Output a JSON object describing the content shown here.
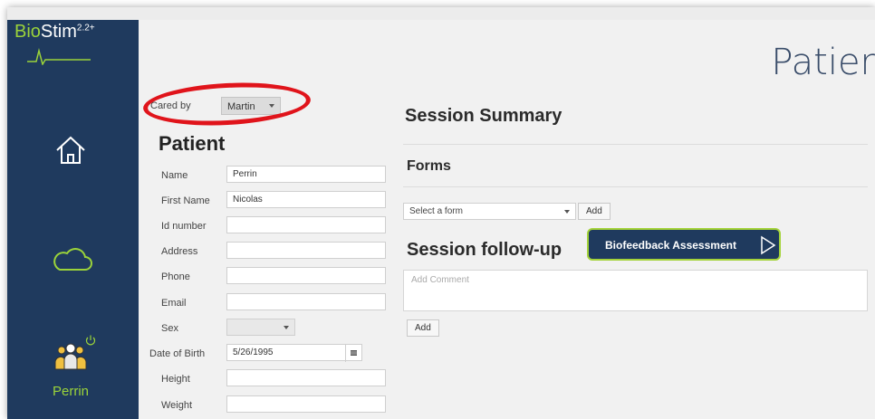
{
  "app": {
    "name": "BioStim",
    "version": "2.2+"
  },
  "sidebar": {
    "user": "Perrin",
    "items": [
      {
        "icon": "home-icon"
      },
      {
        "icon": "cloud-icon"
      },
      {
        "icon": "users-icon"
      }
    ]
  },
  "page_title": "Patier",
  "cared_by": {
    "label": "Cared by",
    "value": "Martin"
  },
  "patient": {
    "heading": "Patient",
    "fields": {
      "name": {
        "label": "Name",
        "value": "Perrin"
      },
      "first_name": {
        "label": "First Name",
        "value": "Nicolas"
      },
      "id_number": {
        "label": "Id number",
        "value": ""
      },
      "address": {
        "label": "Address",
        "value": ""
      },
      "phone": {
        "label": "Phone",
        "value": ""
      },
      "email": {
        "label": "Email",
        "value": ""
      },
      "sex": {
        "label": "Sex",
        "value": ""
      },
      "dob": {
        "label": "Date of Birth",
        "value": "5/26/1995"
      },
      "height": {
        "label": "Height",
        "value": ""
      },
      "weight": {
        "label": "Weight",
        "value": ""
      }
    }
  },
  "session_summary": "Session Summary",
  "forms": {
    "title": "Forms",
    "placeholder": "Select a form",
    "add": "Add"
  },
  "followup": {
    "title": "Session follow-up",
    "biofeedback": "Biofeedback Assessment",
    "comment_placeholder": "Add Comment",
    "add": "Add"
  },
  "colors": {
    "sidebar": "#1f3a5e",
    "accent": "#9bd33a",
    "highlight": "#e0141b"
  }
}
